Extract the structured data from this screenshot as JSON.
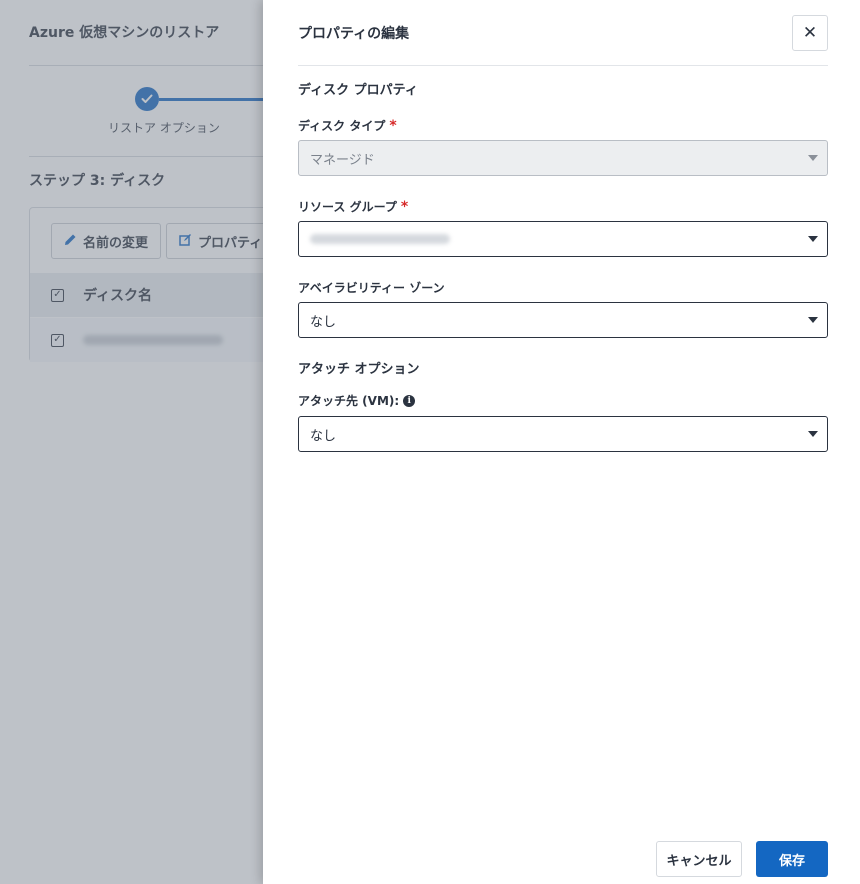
{
  "background": {
    "title": "Azure 仮想マシンのリストア",
    "stepper": {
      "step_label": "リストア オプション"
    },
    "step_title": "ステップ 3: ディスク",
    "toolbar": {
      "rename_label": "名前の変更",
      "properties_label": "プロパティ"
    },
    "table": {
      "header": "ディスク名"
    }
  },
  "drawer": {
    "title": "プロパティの編集",
    "close_glyph": "✕",
    "disk_properties_title": "ディスク プロパティ",
    "disk_type": {
      "label": "ディスク タイプ",
      "required_mark": "*",
      "value": "マネージド"
    },
    "resource_group": {
      "label": "リソース グループ",
      "required_mark": "*"
    },
    "availability_zone": {
      "label": "アベイラビリティー ゾーン",
      "value": "なし"
    },
    "attach_options_title": "アタッチ オプション",
    "attach_to": {
      "label": "アタッチ先 (VM):",
      "info_glyph": "i",
      "value": "なし"
    },
    "cancel_label": "キャンセル",
    "save_label": "保存"
  },
  "colors": {
    "accent": "#1467c2",
    "required": "#d62828",
    "overlay": "#787f8c"
  }
}
